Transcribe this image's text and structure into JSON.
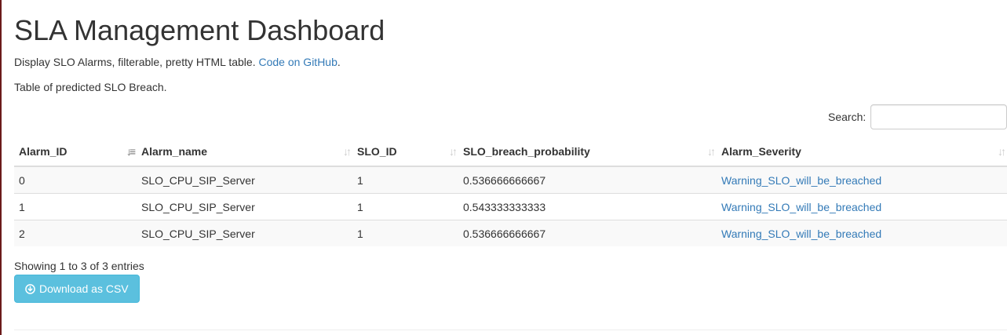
{
  "header": {
    "title": "SLA Management Dashboard",
    "description_prefix": "Display SLO Alarms, filterable, pretty HTML table. ",
    "github_link": "Code on GitHub",
    "description_suffix": ".",
    "table_caption": "Table of predicted SLO Breach."
  },
  "search": {
    "label": "Search:",
    "value": "",
    "placeholder": ""
  },
  "table": {
    "columns": [
      "Alarm_ID",
      "Alarm_name",
      "SLO_ID",
      "SLO_breach_probability",
      "Alarm_Severity"
    ],
    "sorted_column": "Alarm_ID",
    "rows": [
      [
        "0",
        "SLO_CPU_SIP_Server",
        "1",
        "0.536666666667",
        "Warning_SLO_will_be_breached"
      ],
      [
        "1",
        "SLO_CPU_SIP_Server",
        "1",
        "0.543333333333",
        "Warning_SLO_will_be_breached"
      ],
      [
        "2",
        "SLO_CPU_SIP_Server",
        "1",
        "0.536666666667",
        "Warning_SLO_will_be_breached"
      ]
    ]
  },
  "footer": {
    "info": "Showing 1 to 3 of 3 entries",
    "download_label": "Download as CSV"
  },
  "colors": {
    "link": "#337ab7",
    "button_info": "#5bc0de",
    "left_strip": "#6b1a1a"
  },
  "icons": {
    "sort_active": "sort-ascending-icon",
    "sort_inactive": "sort-both-icon",
    "download": "download-circle-icon"
  }
}
